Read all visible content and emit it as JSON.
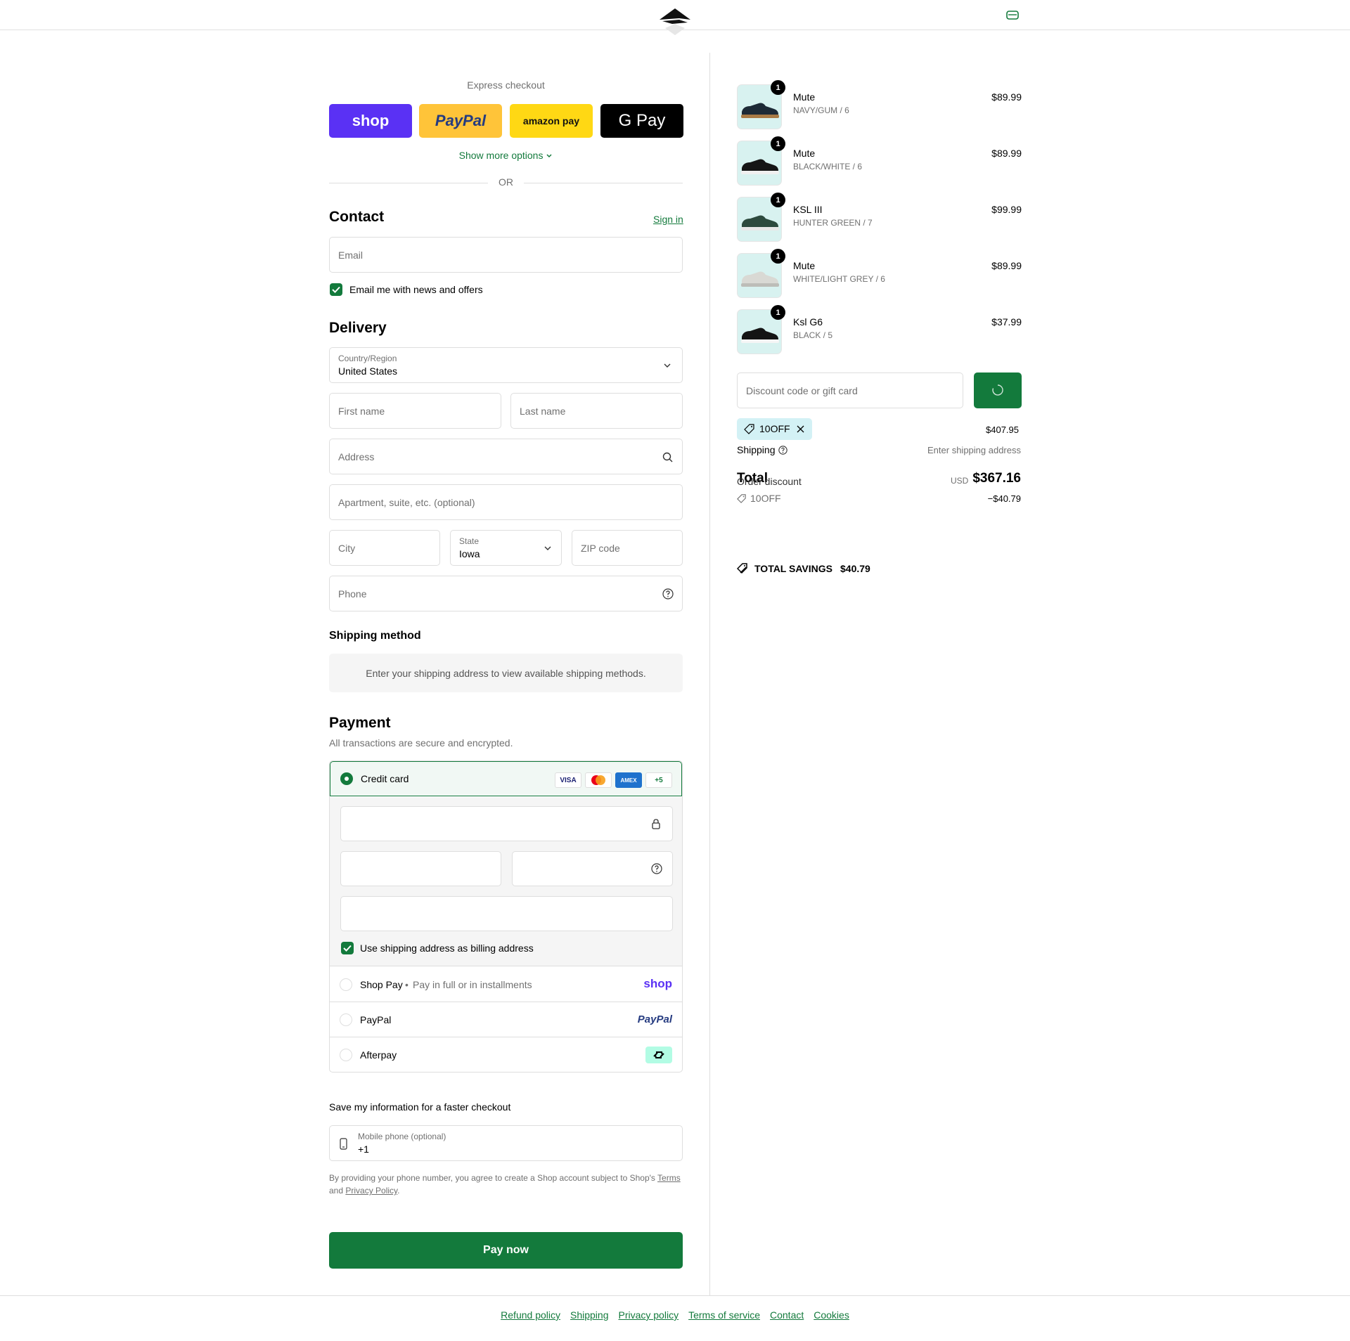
{
  "header": {
    "logo_icon": "brand-wing-logo-icon",
    "cart_icon": "bag-icon"
  },
  "express": {
    "title": "Express checkout",
    "buttons": [
      {
        "label": "shop",
        "color": "#5a31f4"
      },
      {
        "label": "PayPal",
        "color": "#ffc439"
      },
      {
        "label": "amazon pay",
        "color": "#ffd814"
      },
      {
        "label": "G Pay",
        "color": "#000000"
      }
    ],
    "more_options": "Show more options",
    "or": "OR"
  },
  "contact": {
    "title": "Contact",
    "sign_in": "Sign in",
    "email_placeholder": "Email",
    "newsletter": "Email me with news and offers"
  },
  "delivery": {
    "title": "Delivery",
    "country_label": "Country/Region",
    "country_value": "United States",
    "first_name": "First name",
    "last_name": "Last name",
    "address": "Address",
    "apartment": "Apartment, suite, etc. (optional)",
    "city": "City",
    "state_label": "State",
    "state_value": "Iowa",
    "zip": "ZIP code",
    "phone": "Phone"
  },
  "shipping_method": {
    "title": "Shipping method",
    "message": "Enter your shipping address to view available shipping methods."
  },
  "payment": {
    "title": "Payment",
    "subtitle": "All transactions are secure and encrypted.",
    "credit_card": "Credit card",
    "card_logos": [
      "VISA",
      "MC",
      "AMEX",
      "+5"
    ],
    "billing_same": "Use shipping address as billing address",
    "shop_pay": "Shop Pay",
    "shop_pay_sep": "•",
    "shop_pay_desc": "Pay in full or in installments",
    "shop_pay_logo": "shop",
    "paypal": "PayPal",
    "paypal_logo": "PayPal",
    "afterpay": "Afterpay"
  },
  "save_info": {
    "title": "Save my information for a faster checkout",
    "mobile_label": "Mobile phone (optional)",
    "mobile_value": "+1",
    "legal_1": "By providing your phone number, you agree to create a Shop account subject to Shop's ",
    "terms": "Terms",
    "legal_2": "and ",
    "privacy": "Privacy Policy",
    "legal_3": "."
  },
  "pay_now": "Pay now",
  "accent": "#137a3c",
  "cart": {
    "items": [
      {
        "name": "Mute",
        "variant": "NAVY/GUM / 6",
        "price": "$89.99",
        "qty": "1",
        "shoe": "#1d2a36",
        "sole": "#a87a45"
      },
      {
        "name": "Mute",
        "variant": "BLACK/WHITE / 6",
        "price": "$89.99",
        "qty": "1",
        "shoe": "#151515",
        "sole": "#f0f0f0"
      },
      {
        "name": "KSL III",
        "variant": "HUNTER GREEN / 7",
        "price": "$99.99",
        "qty": "1",
        "shoe": "#2d4a3e",
        "sole": "#e8e8e8"
      },
      {
        "name": "Mute",
        "variant": "WHITE/LIGHT GREY / 6",
        "price": "$89.99",
        "qty": "1",
        "shoe": "#d9d9d4",
        "sole": "#bdbdb8"
      },
      {
        "name": "Ksl G6",
        "variant": "BLACK / 5",
        "price": "$37.99",
        "qty": "1",
        "shoe": "#141414",
        "sole": "#f5f5f5"
      }
    ],
    "discount_placeholder": "Discount code or gift card",
    "code_chip": "10OFF",
    "subtotal": "$407.95",
    "shipping_label": "Shipping",
    "shipping_value": "Enter shipping address",
    "total_label": "Total",
    "currency": "USD",
    "total": "$367.16",
    "order_discount_label": "Order discount",
    "discount_code": "10OFF",
    "discount_value": "−$40.79",
    "savings_label": "TOTAL SAVINGS",
    "savings_value": "$40.79"
  },
  "footer": [
    "Refund policy",
    "Shipping",
    "Privacy policy",
    "Terms of service",
    "Contact",
    "Cookies"
  ]
}
